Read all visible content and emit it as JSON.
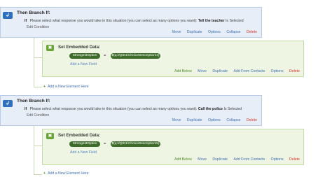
{
  "blocks": [
    {
      "branch": {
        "title": "Then Branch If:",
        "if_label": "If",
        "question": "Please select what response you would take in this situation (you can select as many options you want):",
        "choice": "Tell the teacher",
        "operator": "Is Selected",
        "edit_condition": "Edit Condition",
        "actions": [
          "Move",
          "Duplicate",
          "Options",
          "Collapse",
          "Delete"
        ]
      },
      "embedded": {
        "title": "Set Embedded Data:",
        "field_name": "StrongestOption",
        "equals": "=",
        "field_value": "${q://QID1/ChoiceDescription/4}",
        "add_field": "Add a New Field",
        "actions": [
          "Add Below",
          "Move",
          "Duplicate",
          "Add From Contacts",
          "Options",
          "Delete"
        ]
      },
      "add_element": "Add a New Element Here"
    },
    {
      "branch": {
        "title": "Then Branch If:",
        "if_label": "If",
        "question": "Please select what response you would take in this situation (you can select as many options you want):",
        "choice": "Call the police",
        "operator": "Is Selected",
        "edit_condition": "Edit Condition",
        "actions": [
          "Move",
          "Duplicate",
          "Options",
          "Collapse",
          "Delete"
        ]
      },
      "embedded": {
        "title": "Set Embedded Data:",
        "field_name": "StrongestOption",
        "equals": "=",
        "field_value": "${q://QID1/ChoiceDescription/5}",
        "add_field": "Add a New Field",
        "actions": [
          "Add Below",
          "Move",
          "Duplicate",
          "Add From Contacts",
          "Options",
          "Delete"
        ]
      },
      "add_element": "Add a New Element Here"
    }
  ],
  "icons": {
    "branch": "branch-icon",
    "embedded_data": "embedded-data-icon",
    "add": "plus-icon"
  },
  "colors": {
    "branch_bg": "#e7eef8",
    "embedded_bg": "#eef5e2",
    "link": "#3d6fb0",
    "delete": "#d9342b",
    "pill": "#3d6b2a"
  }
}
